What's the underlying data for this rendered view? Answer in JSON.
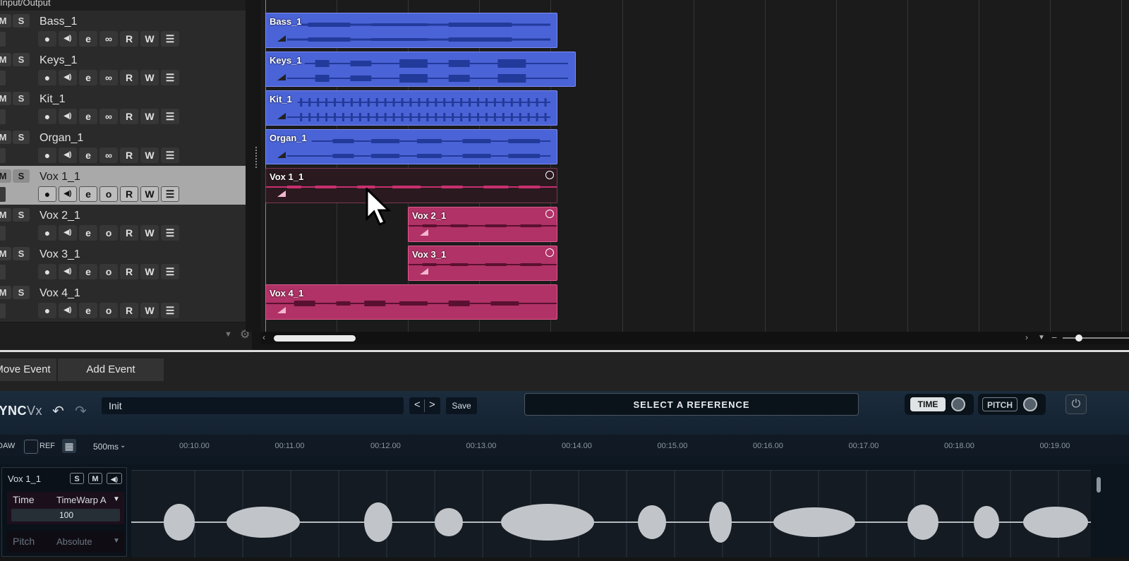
{
  "io_label": "Input/Output",
  "tracks": [
    {
      "m": "M",
      "s": "S",
      "name": "Bass_1",
      "rec": "●",
      "mon": "◀)",
      "e": "e",
      "link": "∞",
      "r": "R",
      "w": "W",
      "ed": "☰"
    },
    {
      "m": "M",
      "s": "S",
      "name": "Keys_1",
      "rec": "●",
      "mon": "◀)",
      "e": "e",
      "link": "∞",
      "r": "R",
      "w": "W",
      "ed": "☰"
    },
    {
      "m": "M",
      "s": "S",
      "name": "Kit_1",
      "rec": "●",
      "mon": "◀)",
      "e": "e",
      "link": "∞",
      "r": "R",
      "w": "W",
      "ed": "☰"
    },
    {
      "m": "M",
      "s": "S",
      "name": "Organ_1",
      "rec": "●",
      "mon": "◀)",
      "e": "e",
      "link": "∞",
      "r": "R",
      "w": "W",
      "ed": "☰"
    },
    {
      "m": "M",
      "s": "S",
      "name": "Vox 1_1",
      "rec": "●",
      "mon": "◀)",
      "e": "e",
      "link": "o",
      "r": "R",
      "w": "W",
      "ed": "☰"
    },
    {
      "m": "M",
      "s": "S",
      "name": "Vox 2_1",
      "rec": "●",
      "mon": "◀)",
      "e": "e",
      "link": "o",
      "r": "R",
      "w": "W",
      "ed": "☰"
    },
    {
      "m": "M",
      "s": "S",
      "name": "Vox 3_1",
      "rec": "●",
      "mon": "◀)",
      "e": "e",
      "link": "o",
      "r": "R",
      "w": "W",
      "ed": "☰"
    },
    {
      "m": "M",
      "s": "S",
      "name": "Vox 4_1",
      "rec": "●",
      "mon": "◀)",
      "e": "e",
      "link": "o",
      "r": "R",
      "w": "W",
      "ed": "☰"
    }
  ],
  "regions": [
    {
      "name": "Bass_1",
      "color": "#4a63d6"
    },
    {
      "name": "Keys_1",
      "color": "#4a63d6"
    },
    {
      "name": "Kit_1",
      "color": "#4a63d6"
    },
    {
      "name": "Organ_1",
      "color": "#4a63d6"
    },
    {
      "name": "Vox 1_1",
      "color": "#2a1a20"
    },
    {
      "name": "Vox 2_1",
      "color": "#b03266"
    },
    {
      "name": "Vox 3_1",
      "color": "#b03266"
    },
    {
      "name": "Vox 4_1",
      "color": "#b03266"
    }
  ],
  "event_bar": {
    "move_event": "Move Event",
    "add_event": "Add Event"
  },
  "plugin": {
    "logo_main": "SYNC",
    "logo_sub": "Vx",
    "undo_icon": "↶",
    "redo_icon": "↷",
    "preset": "Init",
    "prev": "<",
    "next": ">",
    "save": "Save",
    "select_reference": "SELECT A REFERENCE",
    "time": "TIME",
    "pitch": "PITCH",
    "power_icon": "⏻",
    "daw": "DAW",
    "ref": "REF",
    "grid": "500ms",
    "timeline": [
      "00:10.00",
      "00:11.00",
      "00:12.00",
      "00:13.00",
      "00:14.00",
      "00:15.00",
      "00:16.00",
      "00:17.00",
      "00:18.00",
      "00:19.00"
    ],
    "track_panel": {
      "name": "Vox 1_1",
      "s": "S",
      "m": "M",
      "speaker_icon": "◀)",
      "time_label": "Time",
      "time_value": "TimeWarp A",
      "time_amount": "100",
      "pitch_label": "Pitch",
      "pitch_value": "Absolute"
    }
  }
}
